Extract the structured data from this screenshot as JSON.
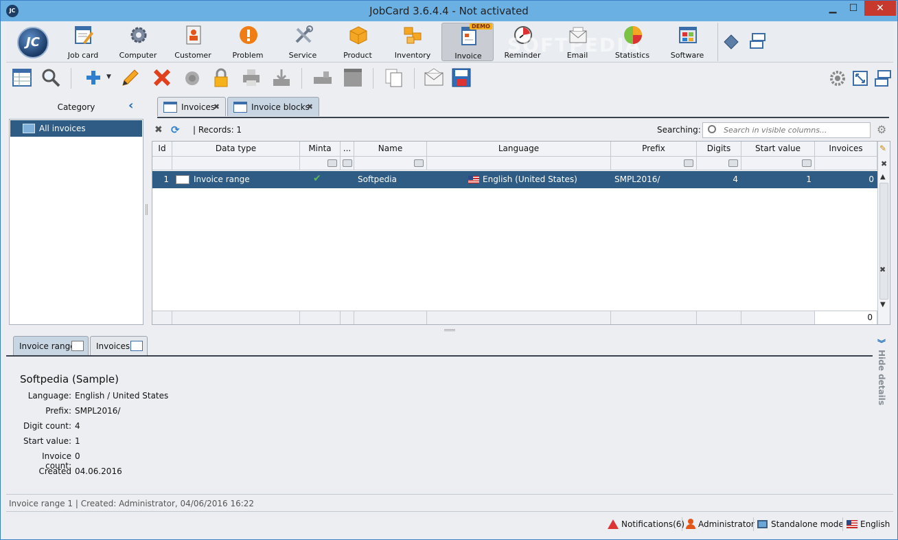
{
  "window": {
    "title": "JobCard 3.6.4.4 - Not activated",
    "app_icon_text": "JC",
    "minimize": "▁",
    "maximize": "☐",
    "close": "✕"
  },
  "ribbon": {
    "logo_text": "JC",
    "watermark": "SOFTPEDIA",
    "demo_badge": "DEMO",
    "modules": [
      {
        "label": "Job card",
        "icon": "job-card-icon"
      },
      {
        "label": "Computer",
        "icon": "computer-gear-icon"
      },
      {
        "label": "Customer",
        "icon": "customer-icon"
      },
      {
        "label": "Problem",
        "icon": "problem-icon"
      },
      {
        "label": "Service",
        "icon": "service-tools-icon"
      },
      {
        "label": "Product",
        "icon": "product-box-icon"
      },
      {
        "label": "Inventory",
        "icon": "inventory-boxes-icon"
      },
      {
        "label": "Invoice",
        "icon": "invoice-icon"
      },
      {
        "label": "Reminder",
        "icon": "reminder-clock-icon"
      },
      {
        "label": "Email",
        "icon": "email-icon"
      },
      {
        "label": "Statistics",
        "icon": "statistics-pie-icon"
      },
      {
        "label": "Software",
        "icon": "software-icon"
      }
    ],
    "active_module": "Invoice"
  },
  "category": {
    "header": "Category",
    "collapse_glyph": "‹",
    "items": [
      {
        "label": "All invoices"
      }
    ]
  },
  "tabs": [
    {
      "label": "Invoices",
      "close": "✖"
    },
    {
      "label": "Invoice blocks",
      "close": "✖"
    }
  ],
  "gridbar": {
    "clear_glyph": "✖",
    "refresh_glyph": "⟳",
    "records": "|   Records: 1",
    "search_label": "Searching:",
    "search_placeholder": "Search in visible columns...",
    "settings_glyph": "⚙"
  },
  "grid": {
    "columns": [
      "Id",
      "Data type",
      "Minta",
      "...",
      "Name",
      "Language",
      "Prefix",
      "Digits",
      "Start value",
      "Invoices"
    ],
    "rows": [
      {
        "id": "1",
        "data_type": "Invoice range",
        "minta": "✔",
        "name": "Softpedia",
        "language": "English (United States)",
        "prefix": "SMPL2016/",
        "digits": "4",
        "start_value": "1",
        "invoices": "0"
      }
    ],
    "footer_sum": "0",
    "footer_clear": "✖",
    "filter_clear": "✖",
    "scroll_up": "▲",
    "scroll_down": "▼",
    "header_icon": "✎"
  },
  "detail_tabs": [
    {
      "label": "Invoice range"
    },
    {
      "label": "Invoices"
    }
  ],
  "hide_details": {
    "arrow": "︾",
    "label": "Hide details"
  },
  "detail": {
    "heading": "Softpedia (Sample)",
    "fields": [
      {
        "k": "Language:",
        "v": "English / United States"
      },
      {
        "k": "Prefix:",
        "v": "SMPL2016/"
      },
      {
        "k": "Digit count:",
        "v": "4"
      },
      {
        "k": "Start value:",
        "v": "1"
      },
      {
        "k": "Invoice count:",
        "v": "0"
      },
      {
        "k": "Created",
        "v": "04.06.2016"
      }
    ]
  },
  "infobar": "Invoice range 1 | Created: Administrator, 04/06/2016 16:22",
  "status": {
    "notifications": "Notifications(6)",
    "user": "Administrator",
    "mode": "Standalone mode",
    "language": "English"
  }
}
